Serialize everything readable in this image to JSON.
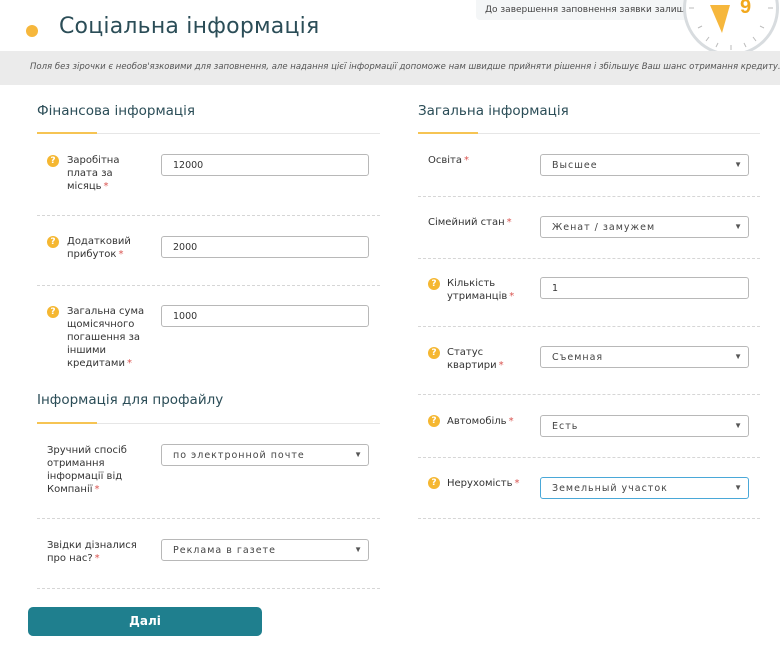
{
  "page_title": "Соціальна інформація",
  "timer_text": "До завершення заповнення заявки залишило",
  "timer_number": "9",
  "info_banner": "Поля без зірочки є необов'язковими для заповнення, але надання цієї інформації допоможе нам швидше прийняти рішення і збільшує Ваш шанс отримання кредиту.",
  "financial": {
    "title": "Фінансова інформація",
    "fields": [
      {
        "label": "Заробітна плата за місяць",
        "required": "*",
        "value": "12000"
      },
      {
        "label": "Додатковий прибуток",
        "required": "*",
        "value": "2000"
      },
      {
        "label": "Загальна сума щомісячного погашення за іншими кредитами",
        "required": "*",
        "value": "1000"
      }
    ]
  },
  "profile": {
    "title": "Інформація для профайлу",
    "fields": [
      {
        "label": "Зручний спосіб отримання інформації від Компанії",
        "required": "*",
        "value": "по электронной почте"
      },
      {
        "label": "Звідки дізналися про нас?",
        "required": "*",
        "value": "Реклама в газете"
      }
    ]
  },
  "general": {
    "title": "Загальна інформація",
    "fields": [
      {
        "label": "Освіта",
        "required": "*",
        "value": "Высшее"
      },
      {
        "label": "Сімейний стан",
        "required": "*",
        "value": "Женат / замужем"
      },
      {
        "label": "Кількість утриманців",
        "required": "*",
        "value": "1"
      },
      {
        "label": "Статус квартири",
        "required": "*",
        "value": "Съемная"
      },
      {
        "label": "Автомобіль",
        "required": "*",
        "value": "Есть"
      },
      {
        "label": "Нерухомість",
        "required": "*",
        "value": "Земельный участок"
      }
    ]
  },
  "icons": {
    "help": "question-icon",
    "caret": "chevron-down-icon",
    "clock": "clock-icon"
  },
  "colors": {
    "accent": "#f6b73c",
    "button": "#1f7f8e",
    "title": "#2b4d57",
    "required": "#d9534f"
  },
  "next_button": "Далі"
}
